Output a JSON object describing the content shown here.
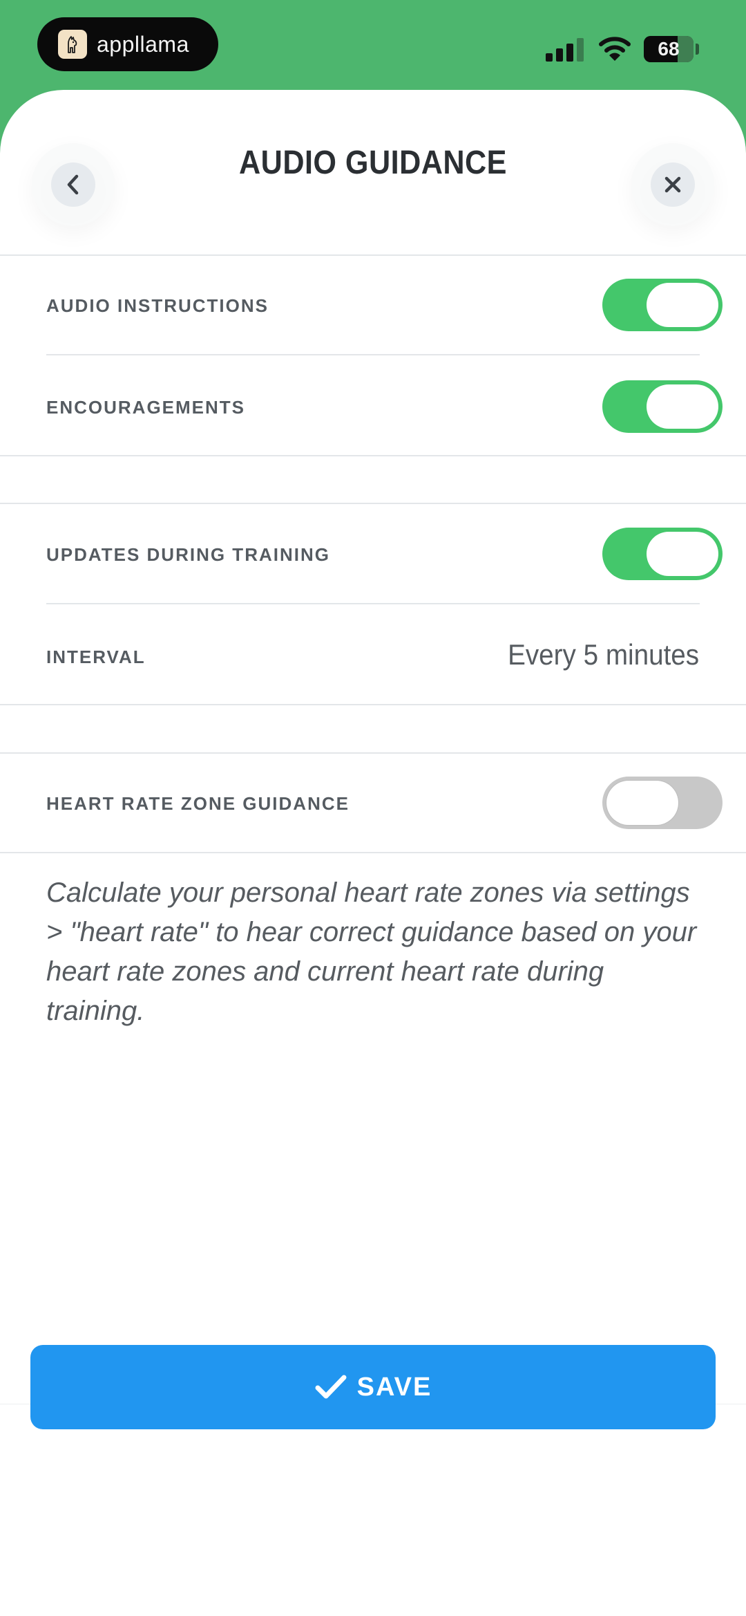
{
  "status_bar": {
    "app_pill_label": "appllama",
    "battery_level": "68",
    "icons": {
      "logo": "llama-logo-icon",
      "signal": "cellular-signal-icon",
      "wifi": "wifi-icon",
      "battery": "battery-icon"
    }
  },
  "header": {
    "title": "AUDIO GUIDANCE",
    "back_icon": "chevron-left-icon",
    "close_icon": "close-icon"
  },
  "sections": {
    "audio_instructions": {
      "label": "AUDIO INSTRUCTIONS",
      "enabled": true
    },
    "encouragements": {
      "label": "ENCOURAGEMENTS",
      "enabled": true
    },
    "updates_during_training": {
      "label": "UPDATES DURING TRAINING",
      "enabled": true
    },
    "interval": {
      "label": "INTERVAL",
      "value": "Every 5 minutes"
    },
    "heart_rate_zone_guidance": {
      "label": "HEART RATE ZONE GUIDANCE",
      "enabled": false
    }
  },
  "hint_text": "Calculate your personal heart rate zones via settings > \"heart rate\" to hear correct guidance based on your heart rate zones and current heart rate during training.",
  "save_button": {
    "label": "SAVE",
    "icon": "checkmark-icon"
  },
  "colors": {
    "header_green": "#4db66e",
    "toggle_on": "#44c76b",
    "toggle_off": "#c8c8c8",
    "save_blue": "#2196f0"
  }
}
